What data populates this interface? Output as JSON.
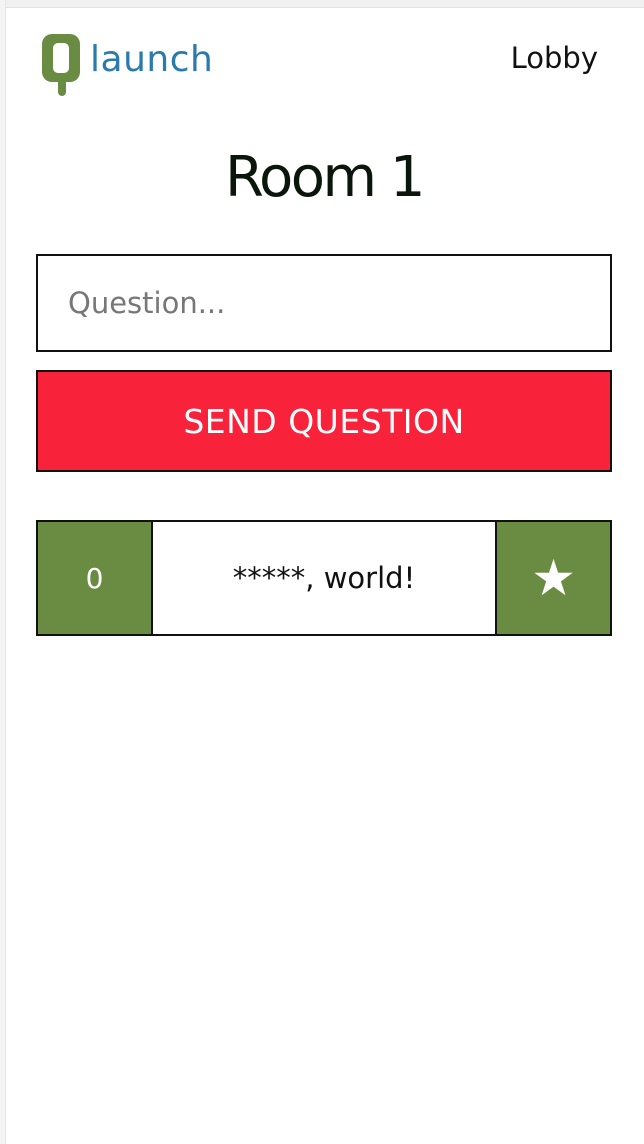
{
  "header": {
    "logo_text": "launch",
    "lobby_label": "Lobby"
  },
  "room": {
    "title": "Room 1"
  },
  "question_form": {
    "placeholder": "Question...",
    "value": "",
    "send_label": "SEND QUESTION"
  },
  "questions": [
    {
      "votes": "0",
      "text": "*****, world!",
      "star_icon": "★"
    }
  ],
  "colors": {
    "brand_green": "#6a8c42",
    "brand_blue": "#2a7aae",
    "send_red": "#f8223a"
  }
}
